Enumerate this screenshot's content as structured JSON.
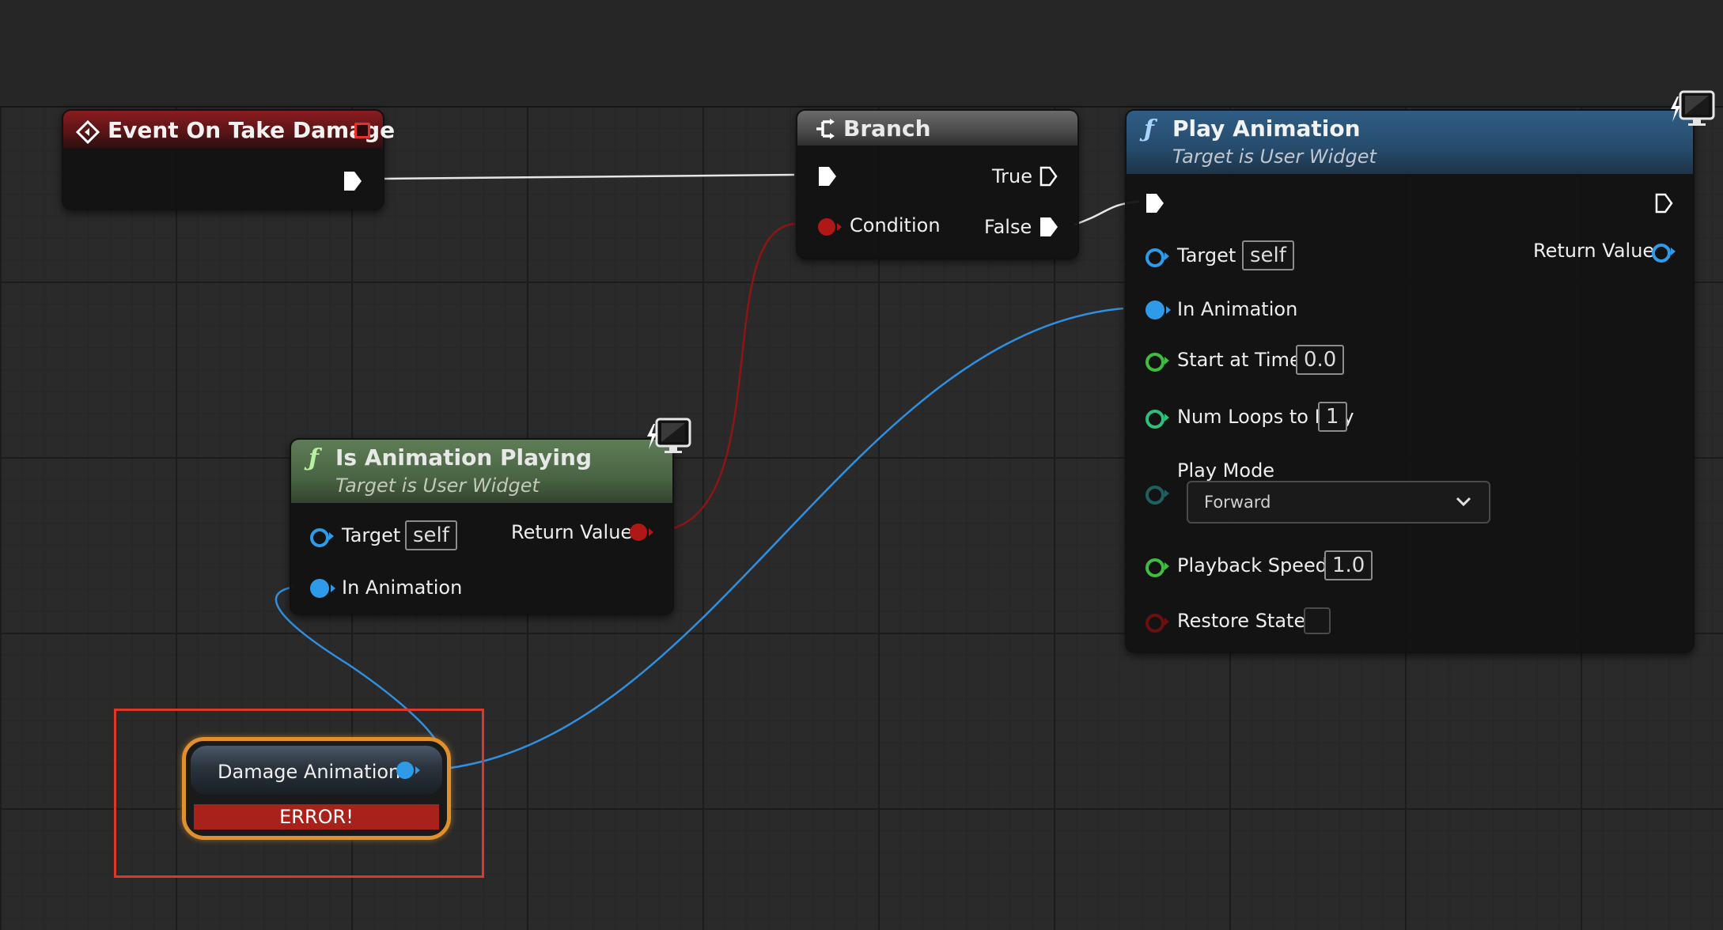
{
  "event_node": {
    "title": "Event On Take Damage"
  },
  "branch_node": {
    "title": "Branch",
    "true_label": "True",
    "false_label": "False",
    "condition_label": "Condition"
  },
  "play_anim_node": {
    "title": "Play Animation",
    "subtitle": "Target is User Widget",
    "target_label": "Target",
    "target_value": "self",
    "return_label": "Return Value",
    "in_anim_label": "In Animation",
    "start_time_label": "Start at Time",
    "start_time_value": "0.0",
    "num_loops_label": "Num Loops to Play",
    "num_loops_value": "1",
    "play_mode_label": "Play Mode",
    "play_mode_value": "Forward",
    "speed_label": "Playback Speed",
    "speed_value": "1.0",
    "restore_label": "Restore State"
  },
  "is_playing_node": {
    "title": "Is Animation Playing",
    "subtitle": "Target is User Widget",
    "target_label": "Target",
    "target_value": "self",
    "return_label": "Return Value",
    "in_anim_label": "In Animation"
  },
  "var_node": {
    "label": "Damage Animation",
    "error": "ERROR!"
  },
  "colors": {
    "exec": "#ffffff",
    "bool": "#a01414",
    "object": "#2f9be8",
    "float": "#3ebd3e",
    "int": "#2fbf7a",
    "error": "#e24b2b"
  },
  "icons": {
    "event": "event-diamond-icon",
    "branch": "branch-icon",
    "function": "function-f-icon",
    "widget": "widget-monitor-icon",
    "chevron": "chevron-down-icon"
  }
}
